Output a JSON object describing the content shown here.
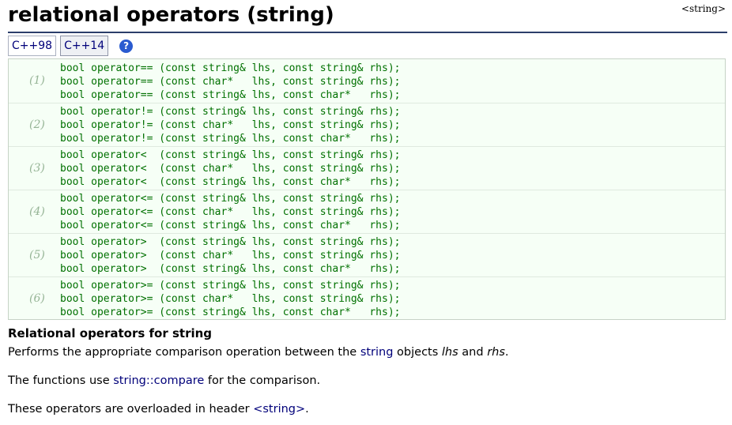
{
  "page": {
    "title": "relational operators (string)",
    "header_tag": "<string>"
  },
  "tabs": [
    {
      "label": "C++98",
      "active": false
    },
    {
      "label": "C++14",
      "active": true
    }
  ],
  "help_icon_symbol": "?",
  "declarations": [
    {
      "number": "(1)",
      "lines": [
        "bool operator== (const string& lhs, const string& rhs);",
        "bool operator== (const char*   lhs, const string& rhs);",
        "bool operator== (const string& lhs, const char*   rhs);"
      ]
    },
    {
      "number": "(2)",
      "lines": [
        "bool operator!= (const string& lhs, const string& rhs);",
        "bool operator!= (const char*   lhs, const string& rhs);",
        "bool operator!= (const string& lhs, const char*   rhs);"
      ]
    },
    {
      "number": "(3)",
      "lines": [
        "bool operator<  (const string& lhs, const string& rhs);",
        "bool operator<  (const char*   lhs, const string& rhs);",
        "bool operator<  (const string& lhs, const char*   rhs);"
      ]
    },
    {
      "number": "(4)",
      "lines": [
        "bool operator<= (const string& lhs, const string& rhs);",
        "bool operator<= (const char*   lhs, const string& rhs);",
        "bool operator<= (const string& lhs, const char*   rhs);"
      ]
    },
    {
      "number": "(5)",
      "lines": [
        "bool operator>  (const string& lhs, const string& rhs);",
        "bool operator>  (const char*   lhs, const string& rhs);",
        "bool operator>  (const string& lhs, const char*   rhs);"
      ]
    },
    {
      "number": "(6)",
      "lines": [
        "bool operator>= (const string& lhs, const string& rhs);",
        "bool operator>= (const char*   lhs, const string& rhs);",
        "bool operator>= (const string& lhs, const char*   rhs);"
      ]
    }
  ],
  "description": {
    "heading": "Relational operators for string",
    "para1": {
      "before": "Performs the appropriate comparison operation between the ",
      "link": "string",
      "middle": " objects ",
      "lhs": "lhs",
      "and": " and ",
      "rhs": "rhs",
      "end": "."
    },
    "para2": {
      "before": "The functions use ",
      "link": "string::compare",
      "after": " for the comparison."
    },
    "para3": {
      "before": "These operators are overloaded in header ",
      "link": "<string>",
      "after": "."
    }
  },
  "colors": {
    "code_text": "#007000",
    "code_background": "#f6fff6",
    "link": "#00007a",
    "title_rule": "#2c3e6a",
    "help_icon": "#2a5bd0"
  }
}
